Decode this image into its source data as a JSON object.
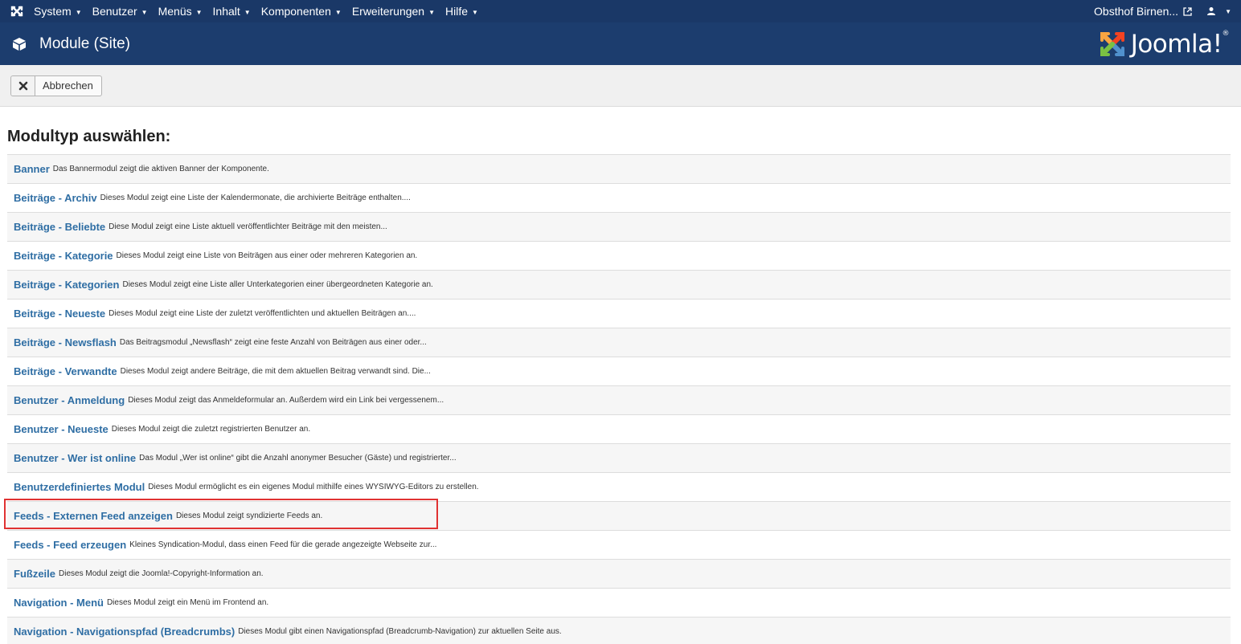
{
  "topbar": {
    "menu": [
      {
        "label": "System"
      },
      {
        "label": "Benutzer"
      },
      {
        "label": "Menüs"
      },
      {
        "label": "Inhalt"
      },
      {
        "label": "Komponenten"
      },
      {
        "label": "Erweiterungen"
      },
      {
        "label": "Hilfe"
      }
    ],
    "site_name": "Obsthof Birnen...",
    "brand_icon": "joomla-icon",
    "user_icon": "user-icon"
  },
  "header": {
    "title": "Module (Site)",
    "title_icon": "cube-icon",
    "logo_text": "Joomla!",
    "logo_mark": "®"
  },
  "toolbar": {
    "cancel_label": "Abbrechen",
    "cancel_icon": "close-icon"
  },
  "main": {
    "heading": "Modultyp auswählen:",
    "modules": [
      {
        "name": "Banner",
        "description": "Das Bannermodul zeigt die aktiven Banner der Komponente."
      },
      {
        "name": "Beiträge - Archiv",
        "description": "Dieses Modul zeigt eine Liste der Kalendermonate, die archivierte Beiträge enthalten...."
      },
      {
        "name": "Beiträge - Beliebte",
        "description": "Diese Modul zeigt eine Liste aktuell veröffentlichter Beiträge mit den meisten..."
      },
      {
        "name": "Beiträge - Kategorie",
        "description": "Dieses Modul zeigt eine Liste von Beiträgen aus einer oder mehreren Kategorien an."
      },
      {
        "name": "Beiträge - Kategorien",
        "description": "Dieses Modul zeigt eine Liste aller Unterkategorien einer übergeordneten Kategorie an."
      },
      {
        "name": "Beiträge - Neueste",
        "description": "Dieses Modul zeigt eine Liste der zuletzt veröffentlichten und aktuellen Beiträgen an...."
      },
      {
        "name": "Beiträge - Newsflash",
        "description": "Das Beitragsmodul „Newsflash“ zeigt eine feste Anzahl von Beiträgen aus einer oder..."
      },
      {
        "name": "Beiträge - Verwandte",
        "description": "Dieses Modul zeigt andere Beiträge, die mit dem aktuellen Beitrag verwandt sind. Die..."
      },
      {
        "name": "Benutzer - Anmeldung",
        "description": "Dieses Modul zeigt das Anmeldeformular an. Außerdem wird ein Link bei vergessenem..."
      },
      {
        "name": "Benutzer - Neueste",
        "description": "Dieses Modul zeigt die zuletzt registrierten Benutzer an."
      },
      {
        "name": "Benutzer - Wer ist online",
        "description": "Das Modul „Wer ist online“ gibt die Anzahl anonymer Besucher (Gäste) und registrierter..."
      },
      {
        "name": "Benutzerdefiniertes Modul",
        "description": "Dieses Modul ermöglicht es ein eigenes Modul mithilfe eines WYSIWYG-Editors zu erstellen."
      },
      {
        "name": "Feeds - Externen Feed anzeigen",
        "description": "Dieses Modul zeigt syndizierte Feeds an.",
        "highlighted": true
      },
      {
        "name": "Feeds - Feed erzeugen",
        "description": "Kleines Syndication-Modul, dass einen Feed für die gerade angezeigte Webseite zur..."
      },
      {
        "name": "Fußzeile",
        "description": "Dieses Modul zeigt die Joomla!-Copyright-Information an."
      },
      {
        "name": "Navigation - Menü",
        "description": "Dieses Modul zeigt ein Menü im Frontend an."
      },
      {
        "name": "Navigation - Navigationspfad (Breadcrumbs)",
        "description": "Dieses Modul gibt einen Navigationspfad (Breadcrumb-Navigation) zur aktuellen Seite aus."
      }
    ]
  },
  "colors": {
    "topbar_bg": "#1a3867",
    "header_bg": "#1c3d6e",
    "link": "#2f6ea4",
    "highlight": "#e03232"
  }
}
